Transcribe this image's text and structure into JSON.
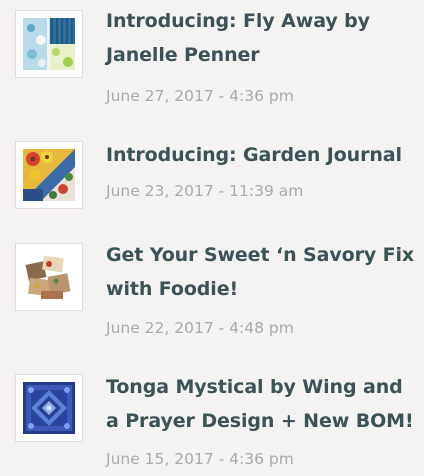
{
  "posts": [
    {
      "title": "Introducing: Fly Away by Janelle Penner",
      "date": "June 27, 2017 - 4:36 pm",
      "thumbnail_icon": "fly-away-fabric-thumbnail"
    },
    {
      "title": "Introducing: Garden Journal",
      "date": "June 23, 2017 - 11:39 am",
      "thumbnail_icon": "garden-journal-fabric-thumbnail"
    },
    {
      "title": "Get Your Sweet ‘n Savory Fix with Foodie!",
      "date": "June 22, 2017 - 4:48 pm",
      "thumbnail_icon": "foodie-fabric-thumbnail"
    },
    {
      "title": "Tonga Mystical by Wing and a Prayer Design + New BOM!",
      "date": "June 15, 2017 - 4:36 pm",
      "thumbnail_icon": "tonga-mystical-quilt-thumbnail"
    }
  ],
  "colors": {
    "title": "#3b5257",
    "date": "#a9a9a9",
    "background": "#f4f3f1"
  }
}
